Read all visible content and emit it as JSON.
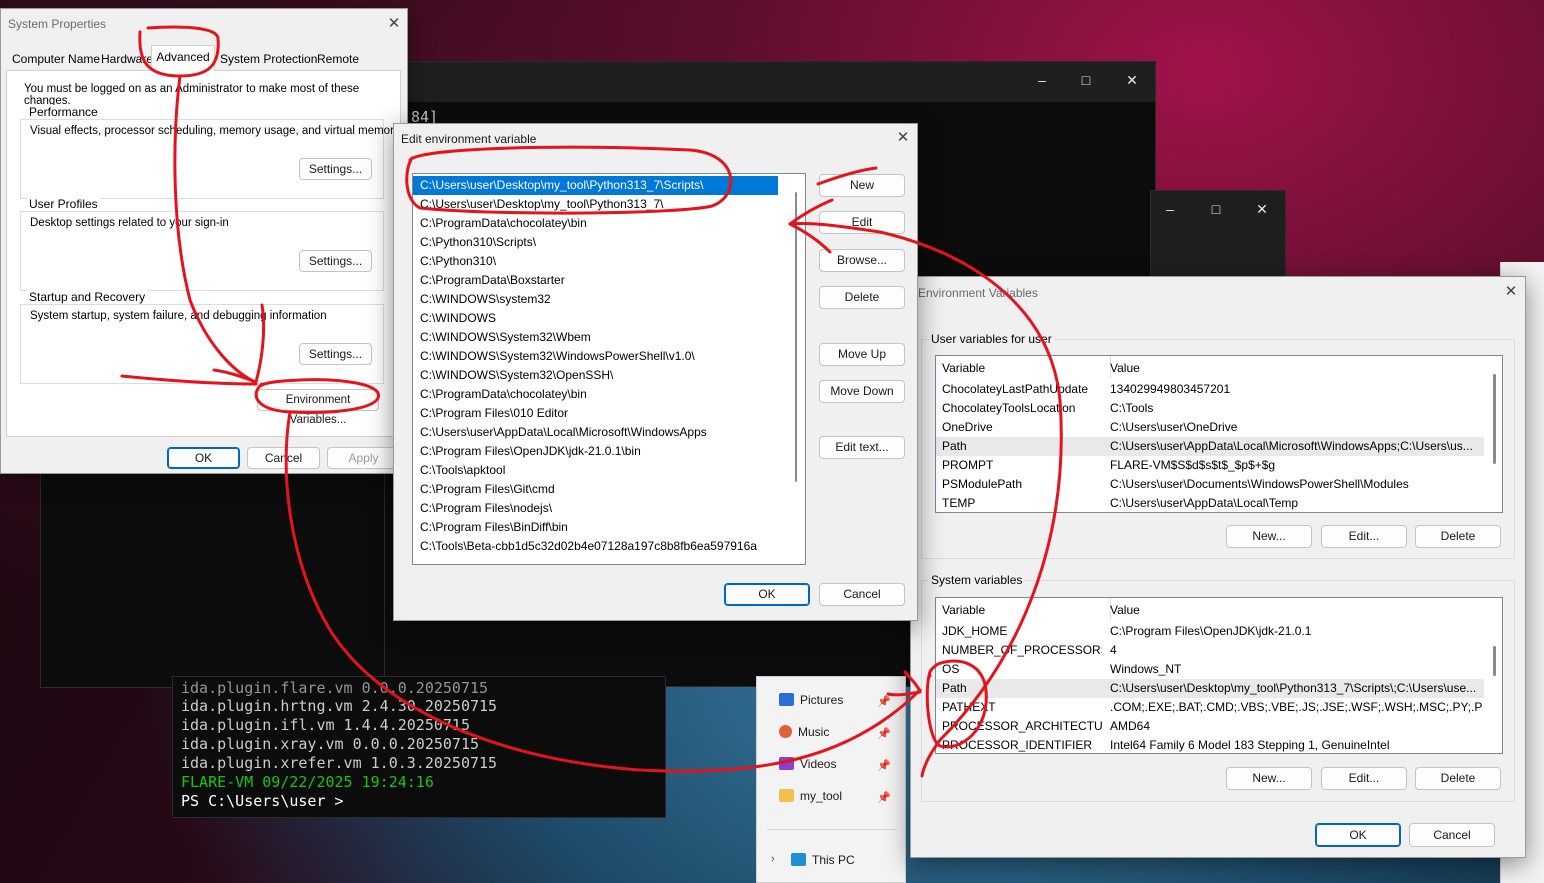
{
  "system_properties": {
    "title": "System Properties",
    "tabs": [
      "Computer Name",
      "Hardware",
      "Advanced",
      "System Protection",
      "Remote"
    ],
    "admin_note": "You must be logged on as an Administrator to make most of these changes.",
    "performance": {
      "label": "Performance",
      "desc": "Visual effects, processor scheduling, memory usage, and virtual memory",
      "button": "Settings..."
    },
    "user_profiles": {
      "label": "User Profiles",
      "desc": "Desktop settings related to your sign-in",
      "button": "Settings..."
    },
    "startup": {
      "label": "Startup and Recovery",
      "desc": "System startup, system failure, and debugging information",
      "button": "Settings..."
    },
    "env_button": "Environment Variables...",
    "ok": "OK",
    "cancel": "Cancel",
    "apply": "Apply"
  },
  "terminal_top": {
    "line": "84]",
    "minimize": "–",
    "maximize": "□",
    "close": "✕"
  },
  "terminal_mid": {
    "minimize": "–",
    "maximize": "□",
    "close": "✕"
  },
  "edit_env": {
    "title": "Edit environment variable",
    "items": [
      "C:\\Users\\user\\Desktop\\my_tool\\Python313_7\\Scripts\\",
      "C:\\Users\\user\\Desktop\\my_tool\\Python313_7\\",
      "C:\\ProgramData\\chocolatey\\bin",
      "C:\\Python310\\Scripts\\",
      "C:\\Python310\\",
      "C:\\ProgramData\\Boxstarter",
      "C:\\WINDOWS\\system32",
      "C:\\WINDOWS",
      "C:\\WINDOWS\\System32\\Wbem",
      "C:\\WINDOWS\\System32\\WindowsPowerShell\\v1.0\\",
      "C:\\WINDOWS\\System32\\OpenSSH\\",
      "C:\\ProgramData\\chocolatey\\bin",
      "C:\\Program Files\\010 Editor",
      "C:\\Users\\user\\AppData\\Local\\Microsoft\\WindowsApps",
      "C:\\Program Files\\OpenJDK\\jdk-21.0.1\\bin",
      "C:\\Tools\\apktool",
      "C:\\Program Files\\Git\\cmd",
      "C:\\Program Files\\nodejs\\",
      "C:\\Program Files\\BinDiff\\bin",
      "C:\\Tools\\Beta-cbb1d5c32d02b4e07128a197c8b8fb6ea597916a"
    ],
    "buttons": {
      "new": "New",
      "edit": "Edit",
      "browse": "Browse...",
      "delete": "Delete",
      "move_up": "Move Up",
      "move_down": "Move Down",
      "edit_text": "Edit text..."
    },
    "ok": "OK",
    "cancel": "Cancel"
  },
  "env_vars": {
    "title": "Environment Variables",
    "user_section": "User variables for user",
    "col_variable": "Variable",
    "col_value": "Value",
    "user_vars": [
      {
        "name": "ChocolateyLastPathUpdate",
        "value": "134029949803457201"
      },
      {
        "name": "ChocolateyToolsLocation",
        "value": "C:\\Tools"
      },
      {
        "name": "OneDrive",
        "value": "C:\\Users\\user\\OneDrive"
      },
      {
        "name": "Path",
        "value": "C:\\Users\\user\\AppData\\Local\\Microsoft\\WindowsApps;C:\\Users\\us..."
      },
      {
        "name": "PROMPT",
        "value": "FLARE-VM$S$d$s$t$_$p$+$g"
      },
      {
        "name": "PSModulePath",
        "value": "C:\\Users\\user\\Documents\\WindowsPowerShell\\Modules"
      },
      {
        "name": "TEMP",
        "value": "C:\\Users\\user\\AppData\\Local\\Temp"
      }
    ],
    "system_section": "System variables",
    "system_vars": [
      {
        "name": "JDK_HOME",
        "value": "C:\\Program Files\\OpenJDK\\jdk-21.0.1"
      },
      {
        "name": "NUMBER_OF_PROCESSORS",
        "value": "4"
      },
      {
        "name": "OS",
        "value": "Windows_NT"
      },
      {
        "name": "Path",
        "value": "C:\\Users\\user\\Desktop\\my_tool\\Python313_7\\Scripts\\;C:\\Users\\use..."
      },
      {
        "name": "PATHEXT",
        "value": ".COM;.EXE;.BAT;.CMD;.VBS;.VBE;.JS;.JSE;.WSF;.WSH;.MSC;.PY;.PYW"
      },
      {
        "name": "PROCESSOR_ARCHITECTURE",
        "value": "AMD64"
      },
      {
        "name": "PROCESSOR_IDENTIFIER",
        "value": "Intel64 Family 6 Model 183 Stepping 1, GenuineIntel"
      }
    ],
    "new": "New...",
    "edit": "Edit...",
    "delete": "Delete",
    "ok": "OK",
    "cancel": "Cancel"
  },
  "terminal_bottom": {
    "lines": [
      "ida.plugin.flare.vm 0.0.0.20250715",
      "ida.plugin.hrtng.vm 2.4.30.20250715",
      "ida.plugin.ifl.vm 1.4.4.20250715",
      "ida.plugin.xray.vm 0.0.0.20250715",
      "ida.plugin.xrefer.vm 1.0.3.20250715",
      "FLARE-VM 09/22/2025 19:24:16",
      "PS C:\\Users\\user >"
    ],
    "prompt_color": "#16c60c"
  },
  "explorer": {
    "items": [
      "Pictures",
      "Music",
      "Videos",
      "my_tool"
    ],
    "this_pc": "This PC"
  },
  "annotation_color": "#e3141b"
}
